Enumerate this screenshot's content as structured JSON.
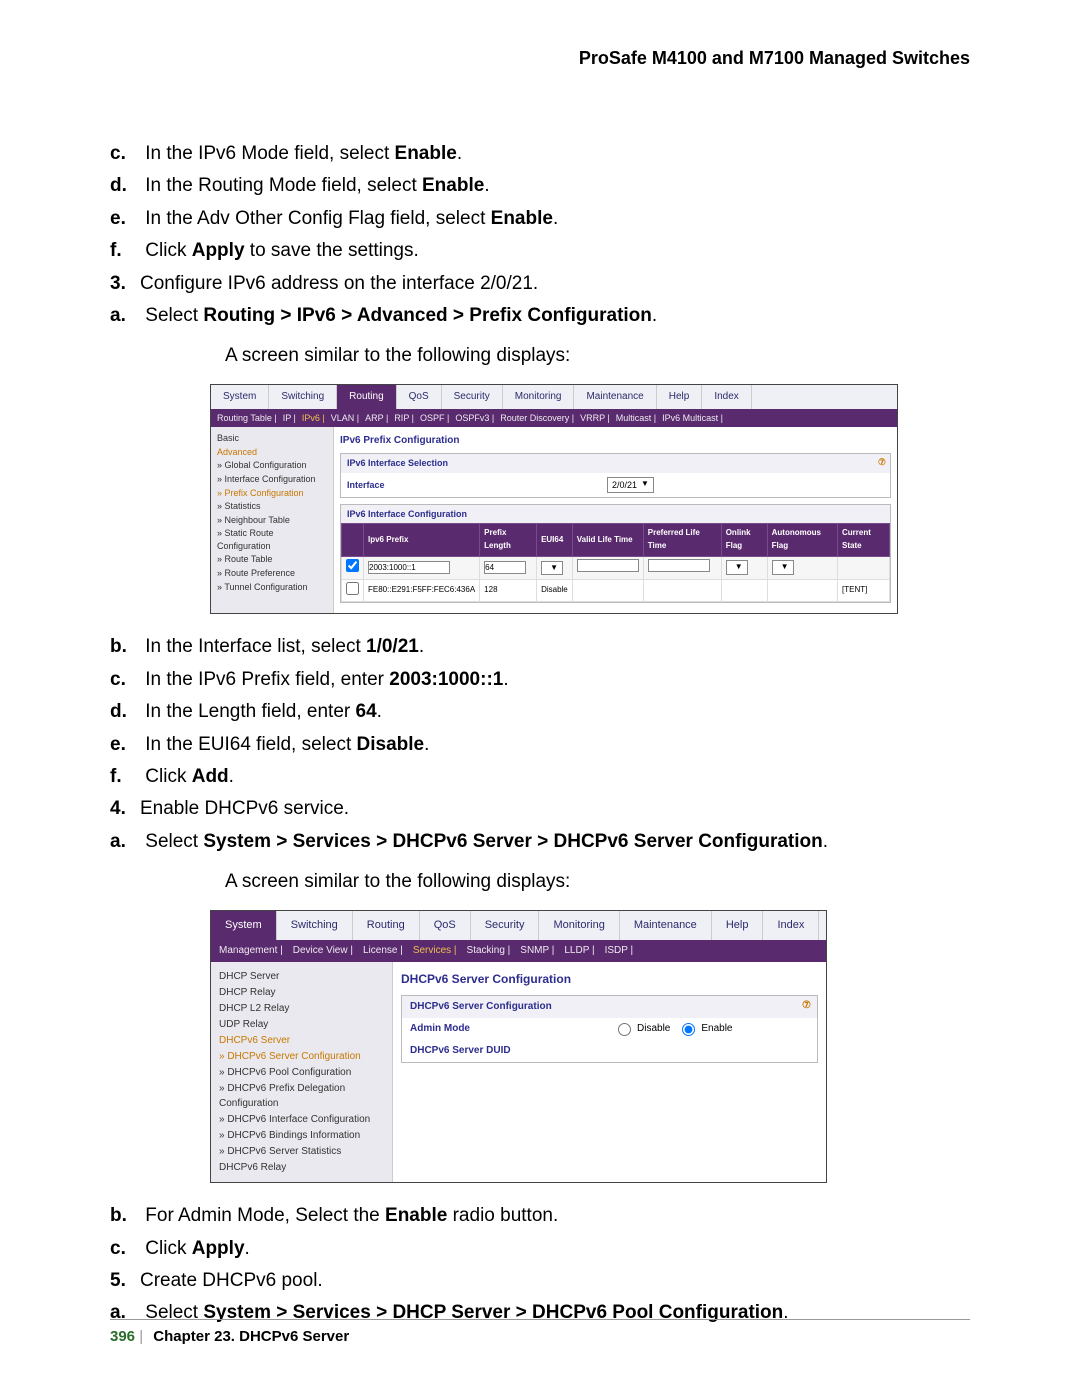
{
  "header": "ProSafe M4100 and M7100 Managed Switches",
  "instructions": {
    "c": {
      "pre": "In the IPv6 Mode field, select ",
      "bold": "Enable",
      "post": "."
    },
    "d": {
      "pre": "In the Routing Mode field, select ",
      "bold": "Enable",
      "post": "."
    },
    "e": {
      "pre": "In the Adv Other Config Flag field, select ",
      "bold": "Enable",
      "post": "."
    },
    "f": {
      "pre": "Click ",
      "bold": "Apply",
      "post": " to save the settings."
    },
    "s3": "Configure IPv6 address on the interface 2/0/21.",
    "s3a": {
      "pre": "Select ",
      "bold": "Routing > IPv6 > Advanced > Prefix Configuration",
      "post": "."
    },
    "s3a2": "A screen similar to the following displays:",
    "s3b": {
      "pre": "In the Interface list, select ",
      "bold": "1/0/21",
      "post": "."
    },
    "s3c": {
      "pre": "In the IPv6 Prefix field, enter ",
      "bold": "2003:1000::1",
      "post": "."
    },
    "s3d": {
      "pre": "In the Length field, enter ",
      "bold": "64",
      "post": "."
    },
    "s3e": {
      "pre": "In the EUI64 field, select ",
      "bold": "Disable",
      "post": "."
    },
    "s3f": {
      "pre": "Click ",
      "bold": "Add",
      "post": "."
    },
    "s4": "Enable DHCPv6 service.",
    "s4a": {
      "pre": "Select ",
      "bold": "System > Services > DHCPv6 Server > DHCPv6 Server Configuration",
      "post": "."
    },
    "s4a2": "A screen similar to the following displays:",
    "s4b": {
      "pre": "For Admin Mode, Select the ",
      "bold": "Enable",
      "post": " radio button."
    },
    "s4c": {
      "pre": "Click ",
      "bold": "Apply",
      "post": "."
    },
    "s5": "Create DHCPv6 pool.",
    "s5a": {
      "pre": "Select ",
      "bold": "System > Services > DHCP Server > DHCPv6 Pool Configuration",
      "post": "."
    }
  },
  "shot1": {
    "tabs": [
      "System",
      "Switching",
      "Routing",
      "QoS",
      "Security",
      "Monitoring",
      "Maintenance",
      "Help",
      "Index"
    ],
    "tabs_active": "Routing",
    "subtabs": [
      "Routing Table",
      "IP",
      "IPv6",
      "VLAN",
      "ARP",
      "RIP",
      "OSPF",
      "OSPFv3",
      "Router Discovery",
      "VRRP",
      "Multicast",
      "IPv6 Multicast"
    ],
    "subtabs_hl": "IPv6",
    "side": [
      "Basic",
      "Advanced",
      "» Global Configuration",
      "» Interface Configuration",
      "» Prefix Configuration",
      "» Statistics",
      "» Neighbour Table",
      "» Static Route Configuration",
      "» Route Table",
      "» Route Preference",
      "» Tunnel Configuration"
    ],
    "side_hl": [
      "Advanced",
      "» Prefix Configuration"
    ],
    "title": "IPv6 Prefix Configuration",
    "sel_box": {
      "hdr": "IPv6 Interface Selection",
      "lbl": "Interface",
      "value": "2/0/21"
    },
    "tbl_box_hdr": "IPv6 Interface Configuration",
    "cols": [
      "",
      "Ipv6 Prefix",
      "Prefix Length",
      "EUI64",
      "Valid Life Time",
      "Preferred Life Time",
      "Onlink Flag",
      "Autonomous Flag",
      "Current State"
    ],
    "row_edit": {
      "prefix": "2003:1000::1",
      "len": "64",
      "eui": "",
      "valid": "",
      "pref": "",
      "on": "",
      "auto": "",
      "state": ""
    },
    "row_ro": {
      "prefix": "FE80::E291:F5FF:FEC6:436A",
      "len": "128",
      "eui": "",
      "valid": "",
      "pref": "",
      "on": "",
      "auto": "",
      "state": "[TENT]"
    },
    "eui_disable": "Disable"
  },
  "shot2": {
    "tabs": [
      "System",
      "Switching",
      "Routing",
      "QoS",
      "Security",
      "Monitoring",
      "Maintenance",
      "Help",
      "Index"
    ],
    "tabs_active": "System",
    "subtabs": [
      "Management",
      "Device View",
      "License",
      "Services",
      "Stacking",
      "SNMP",
      "LLDP",
      "ISDP"
    ],
    "subtabs_hl": "Services",
    "side": [
      "DHCP Server",
      "DHCP Relay",
      "DHCP L2 Relay",
      "UDP Relay",
      "DHCPv6 Server",
      "» DHCPv6 Server Configuration",
      "» DHCPv6 Pool Configuration",
      "» DHCPv6 Prefix Delegation Configuration",
      "» DHCPv6 Interface Configuration",
      "» DHCPv6 Bindings Information",
      "» DHCPv6 Server Statistics",
      "DHCPv6 Relay"
    ],
    "side_hl": [
      "DHCPv6 Server",
      "» DHCPv6 Server Configuration"
    ],
    "title": "DHCPv6 Server Configuration",
    "box_hdr": "DHCPv6 Server Configuration",
    "rows": {
      "admin_lbl": "Admin Mode",
      "disable": "Disable",
      "enable": "Enable",
      "duid_lbl": "DHCPv6 Server DUID"
    }
  },
  "footer": {
    "page": "396",
    "chapter": "Chapter 23.  DHCPv6 Server"
  }
}
